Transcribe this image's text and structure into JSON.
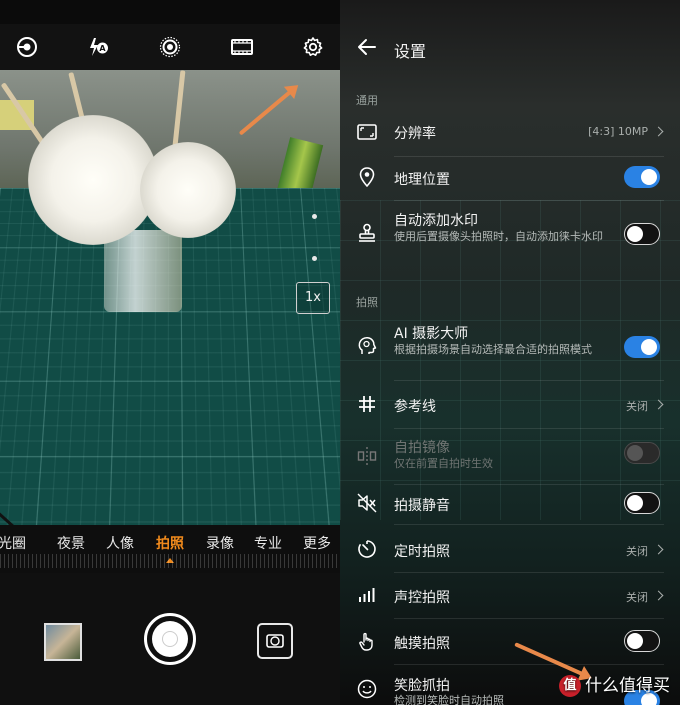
{
  "camera": {
    "top_icons": [
      "hdr-lens-icon",
      "flash-auto-icon",
      "live-photo-icon",
      "film-filter-icon",
      "settings-gear-icon"
    ],
    "zoom_label": "1x",
    "modes": [
      "光圈",
      "夜景",
      "人像",
      "拍照",
      "录像",
      "专业",
      "更多"
    ],
    "active_mode": "拍照",
    "accent_color": "#f08a1c"
  },
  "settings": {
    "title": "设置",
    "section_general": "通用",
    "section_photo": "拍照",
    "rows": {
      "resolution": {
        "label": "分辨率",
        "value": "[4:3] 10MP"
      },
      "location": {
        "label": "地理位置",
        "toggle": "on"
      },
      "watermark": {
        "label": "自动添加水印",
        "sub": "使用后置摄像头拍照时，自动添加徕卡水印",
        "toggle": "off"
      },
      "ai_master": {
        "label": "AI 摄影大师",
        "sub": "根据拍摄场景自动选择最合适的拍照模式",
        "toggle": "on"
      },
      "gridlines": {
        "label": "参考线",
        "value": "关闭"
      },
      "mirror": {
        "label": "自拍镜像",
        "sub": "仅在前置自拍时生效",
        "toggle": "disabled"
      },
      "mute": {
        "label": "拍摄静音",
        "toggle": "off"
      },
      "timer": {
        "label": "定时拍照",
        "value": "关闭"
      },
      "voice": {
        "label": "声控拍照",
        "value": "关闭"
      },
      "touch": {
        "label": "触摸拍照",
        "toggle": "off"
      },
      "smile": {
        "label": "笑脸抓拍",
        "sub": "检测到笑脸时自动拍照",
        "toggle": "on"
      }
    },
    "toggle_on_color": "#2a82e4"
  },
  "watermark_text": {
    "badge": "值",
    "text": "什么值得买"
  }
}
